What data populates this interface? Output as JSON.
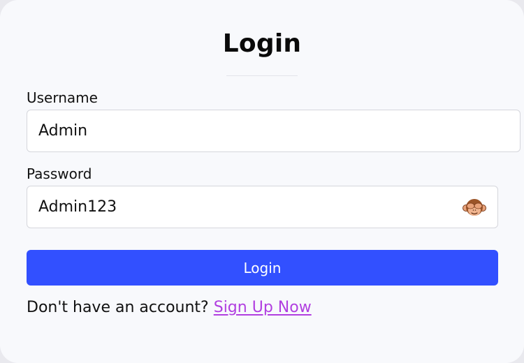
{
  "form": {
    "title": "Login",
    "username_label": "Username",
    "username_value": "Admin",
    "password_label": "Password",
    "password_value": "Admin123",
    "password_toggle_icon": "see-no-evil-monkey-icon",
    "submit_label": "Login",
    "signup_prompt": "Don't have an account?",
    "signup_link": "Sign Up Now"
  },
  "colors": {
    "primary_button": "#3250ff",
    "link": "#b13fe0",
    "card_background": "#f8f9fc"
  }
}
